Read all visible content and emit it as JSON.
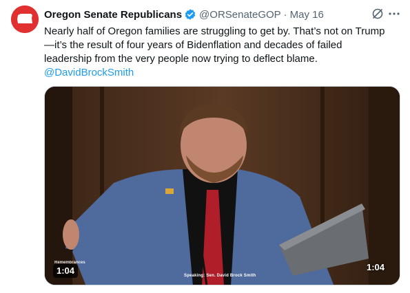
{
  "tweet": {
    "author_name": "Oregon Senate Republicans",
    "handle": "@ORSenateGOP",
    "separator": "·",
    "date": "May 16",
    "text_lines": [
      "Nearly half of Oregon families are struggling to get by. That’s not on Trump",
      "—it’s the result of four years of Bidenflation and decades of failed",
      "leadership from the very people now trying to deflect blame."
    ],
    "mention": "@DavidBrockSmith"
  },
  "video": {
    "duration_badge": "1:04",
    "duration_right": "1:04",
    "caption": "Speaking: Sen. David Brock Smith",
    "corner_label": "Remembrances"
  },
  "colors": {
    "accent": "#1d9bf0",
    "avatar_bg": "#e0302f",
    "text": "#0f1419",
    "muted": "#536471"
  },
  "icons": [
    "oregon-logo-icon",
    "verified-badge-icon",
    "grok-icon",
    "more-icon"
  ]
}
